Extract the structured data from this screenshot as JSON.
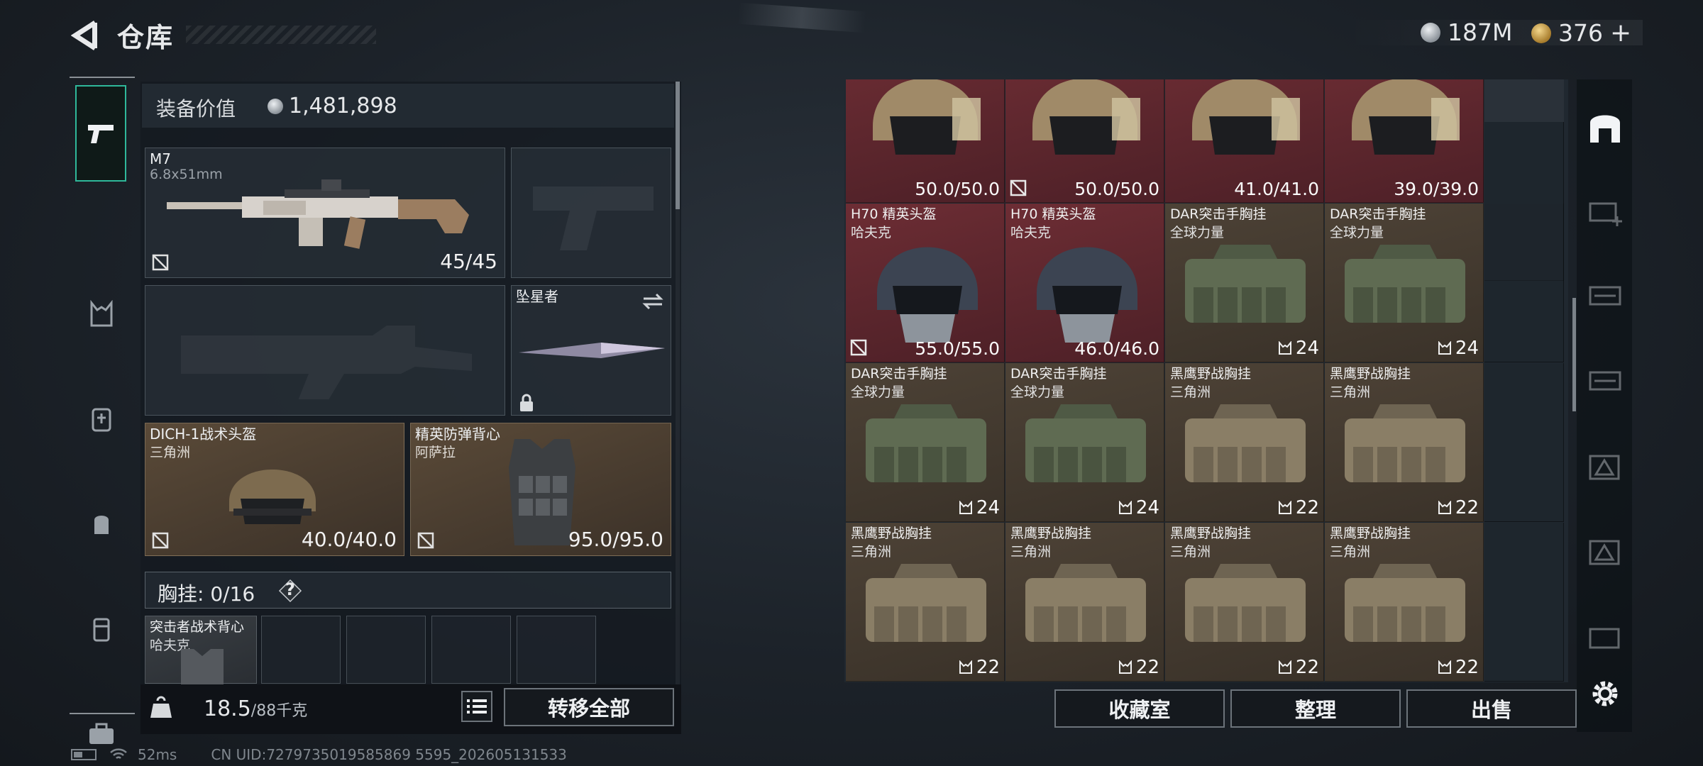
{
  "header": {
    "title": "仓库",
    "currency_silver": "187M",
    "currency_gold": "376",
    "currency_gold_plus": "+"
  },
  "equipment": {
    "value_label": "装备价值",
    "value": "1,481,898",
    "primary_weapon": {
      "name": "M7",
      "caliber": "6.8x51mm",
      "ammo": "45/45"
    },
    "melee": {
      "name": "坠星者"
    },
    "helmet": {
      "name": "DICH-1战术头盔",
      "brand": "三角洲",
      "durability": "40.0/40.0"
    },
    "armor": {
      "name": "精英防弹背心",
      "brand": "阿萨拉",
      "durability": "95.0/95.0"
    },
    "chest_rig": {
      "label": "胸挂:",
      "count": "0/16",
      "help": "?"
    },
    "backpack_slot": {
      "name": "突击者战术背心",
      "brand": "哈夫克"
    },
    "weight": "18.5",
    "weight_max": "/88千克",
    "transfer_all": "转移全部"
  },
  "inventory": {
    "items": [
      {
        "name": "",
        "sub": "",
        "value": "50.0/50.0",
        "color": "red",
        "kind": "helmet-tan",
        "badge": false
      },
      {
        "name": "",
        "sub": "",
        "value": "50.0/50.0",
        "color": "red",
        "kind": "helmet-tan",
        "badge": true
      },
      {
        "name": "",
        "sub": "",
        "value": "41.0/41.0",
        "color": "red",
        "kind": "helmet-tan",
        "badge": false
      },
      {
        "name": "",
        "sub": "",
        "value": "39.0/39.0",
        "color": "red",
        "kind": "helmet-tan",
        "badge": false
      },
      {
        "name": "H70 精英头盔",
        "sub": "哈夫克",
        "value": "55.0/55.0",
        "color": "red",
        "kind": "helmet-dark",
        "badge": true
      },
      {
        "name": "H70 精英头盔",
        "sub": "哈夫克",
        "value": "46.0/46.0",
        "color": "red",
        "kind": "helmet-dark",
        "badge": false
      },
      {
        "name": "DAR突击手胸挂",
        "sub": "全球力量",
        "count": "24",
        "color": "tan",
        "kind": "rig-green"
      },
      {
        "name": "DAR突击手胸挂",
        "sub": "全球力量",
        "count": "24",
        "color": "tan",
        "kind": "rig-green"
      },
      {
        "name": "DAR突击手胸挂",
        "sub": "全球力量",
        "count": "24",
        "color": "tan",
        "kind": "rig-green"
      },
      {
        "name": "DAR突击手胸挂",
        "sub": "全球力量",
        "count": "24",
        "color": "tan",
        "kind": "rig-green"
      },
      {
        "name": "黑鹰野战胸挂",
        "sub": "三角洲",
        "count": "22",
        "color": "tan",
        "kind": "rig-tan"
      },
      {
        "name": "黑鹰野战胸挂",
        "sub": "三角洲",
        "count": "22",
        "color": "tan",
        "kind": "rig-tan"
      },
      {
        "name": "黑鹰野战胸挂",
        "sub": "三角洲",
        "count": "22",
        "color": "tan",
        "kind": "rig-tan"
      },
      {
        "name": "黑鹰野战胸挂",
        "sub": "三角洲",
        "count": "22",
        "color": "tan",
        "kind": "rig-tan"
      },
      {
        "name": "黑鹰野战胸挂",
        "sub": "三角洲",
        "count": "22",
        "color": "tan",
        "kind": "rig-tan"
      },
      {
        "name": "黑鹰野战胸挂",
        "sub": "三角洲",
        "count": "22",
        "color": "tan",
        "kind": "rig-tan"
      }
    ],
    "buttons": {
      "collection": "收藏室",
      "organize": "整理",
      "sell": "出售"
    }
  },
  "status_bar": {
    "ping": "52ms",
    "uid": "CN UID:7279735019585869 5595_202605131533"
  }
}
